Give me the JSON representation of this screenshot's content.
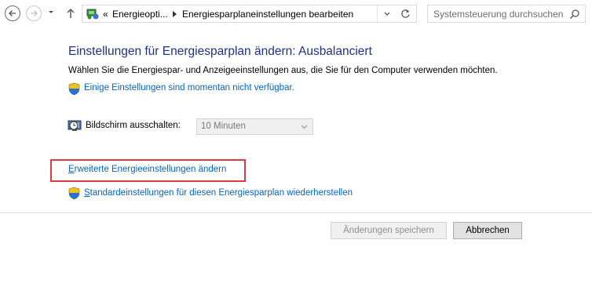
{
  "navbar": {
    "breadcrumb_prefix": "«",
    "crumb1": "Energieopti...",
    "crumb2": "Energiesparplaneinstellungen bearbeiten",
    "search_placeholder": "Systemsteuerung durchsuchen"
  },
  "content": {
    "heading": "Einstellungen für Energiesparplan ändern: Ausbalanciert",
    "description": "Wählen Sie die Energiespar- und Anzeigeeinstellungen aus, die Sie für den Computer verwenden möchten.",
    "unavailable_link": "Einige Einstellungen sind momentan nicht verfügbar.",
    "screen_off_label": "Bildschirm ausschalten:",
    "screen_off_value": "10 Minuten",
    "advanced_link_first": "E",
    "advanced_link_rest": "rweiterte Energieeinstellungen ändern",
    "restore_link_first": "S",
    "restore_link_rest": "tandardeinstellungen für diesen Energiesparplan wiederherstellen"
  },
  "buttons": {
    "save": "Änderungen speichern",
    "cancel": "Abbrechen"
  },
  "colors": {
    "heading": "#1e3287",
    "link": "#0066cc",
    "highlight_border": "#e0393e"
  },
  "icons": {
    "back": "back-arrow-icon",
    "forward": "forward-arrow-icon",
    "recent": "chevron-down-icon",
    "up": "up-arrow-icon",
    "control_panel": "control-panel-icon",
    "refresh": "refresh-icon",
    "search": "search-icon",
    "shield": "uac-shield-icon",
    "display": "display-clock-icon"
  }
}
